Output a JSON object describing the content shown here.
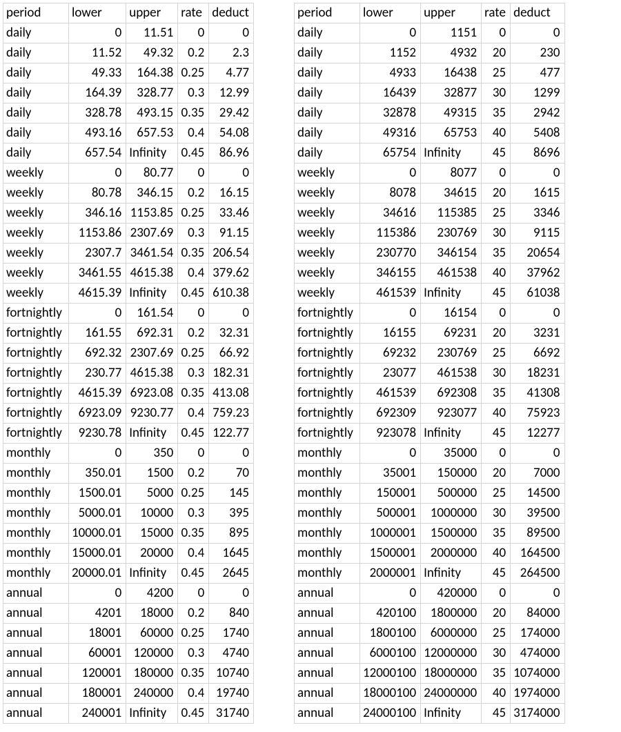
{
  "headers": [
    "period",
    "lower",
    "upper",
    "rate",
    "deduct"
  ],
  "tableLeft": [
    [
      "daily",
      "0",
      "11.51",
      "0",
      "0"
    ],
    [
      "daily",
      "11.52",
      "49.32",
      "0.2",
      "2.3"
    ],
    [
      "daily",
      "49.33",
      "164.38",
      "0.25",
      "4.77"
    ],
    [
      "daily",
      "164.39",
      "328.77",
      "0.3",
      "12.99"
    ],
    [
      "daily",
      "328.78",
      "493.15",
      "0.35",
      "29.42"
    ],
    [
      "daily",
      "493.16",
      "657.53",
      "0.4",
      "54.08"
    ],
    [
      "daily",
      "657.54",
      "Infinity",
      "0.45",
      "86.96"
    ],
    [
      "weekly",
      "0",
      "80.77",
      "0",
      "0"
    ],
    [
      "weekly",
      "80.78",
      "346.15",
      "0.2",
      "16.15"
    ],
    [
      "weekly",
      "346.16",
      "1153.85",
      "0.25",
      "33.46"
    ],
    [
      "weekly",
      "1153.86",
      "2307.69",
      "0.3",
      "91.15"
    ],
    [
      "weekly",
      "2307.7",
      "3461.54",
      "0.35",
      "206.54"
    ],
    [
      "weekly",
      "3461.55",
      "4615.38",
      "0.4",
      "379.62"
    ],
    [
      "weekly",
      "4615.39",
      "Infinity",
      "0.45",
      "610.38"
    ],
    [
      "fortnightly",
      "0",
      "161.54",
      "0",
      "0"
    ],
    [
      "fortnightly",
      "161.55",
      "692.31",
      "0.2",
      "32.31"
    ],
    [
      "fortnightly",
      "692.32",
      "2307.69",
      "0.25",
      "66.92"
    ],
    [
      "fortnightly",
      "230.77",
      "4615.38",
      "0.3",
      "182.31"
    ],
    [
      "fortnightly",
      "4615.39",
      "6923.08",
      "0.35",
      "413.08"
    ],
    [
      "fortnightly",
      "6923.09",
      "9230.77",
      "0.4",
      "759.23"
    ],
    [
      "fortnightly",
      "9230.78",
      "Infinity",
      "0.45",
      "122.77"
    ],
    [
      "monthly",
      "0",
      "350",
      "0",
      "0"
    ],
    [
      "monthly",
      "350.01",
      "1500",
      "0.2",
      "70"
    ],
    [
      "monthly",
      "1500.01",
      "5000",
      "0.25",
      "145"
    ],
    [
      "monthly",
      "5000.01",
      "10000",
      "0.3",
      "395"
    ],
    [
      "monthly",
      "10000.01",
      "15000",
      "0.35",
      "895"
    ],
    [
      "monthly",
      "15000.01",
      "20000",
      "0.4",
      "1645"
    ],
    [
      "monthly",
      "20000.01",
      "Infinity",
      "0.45",
      "2645"
    ],
    [
      "annual",
      "0",
      "4200",
      "0",
      "0"
    ],
    [
      "annual",
      "4201",
      "18000",
      "0.2",
      "840"
    ],
    [
      "annual",
      "18001",
      "60000",
      "0.25",
      "1740"
    ],
    [
      "annual",
      "60001",
      "120000",
      "0.3",
      "4740"
    ],
    [
      "annual",
      "120001",
      "180000",
      "0.35",
      "10740"
    ],
    [
      "annual",
      "180001",
      "240000",
      "0.4",
      "19740"
    ],
    [
      "annual",
      "240001",
      "Infinity",
      "0.45",
      "31740"
    ]
  ],
  "tableRight": [
    [
      "daily",
      "0",
      "1151",
      "0",
      "0"
    ],
    [
      "daily",
      "1152",
      "4932",
      "20",
      "230"
    ],
    [
      "daily",
      "4933",
      "16438",
      "25",
      "477"
    ],
    [
      "daily",
      "16439",
      "32877",
      "30",
      "1299"
    ],
    [
      "daily",
      "32878",
      "49315",
      "35",
      "2942"
    ],
    [
      "daily",
      "49316",
      "65753",
      "40",
      "5408"
    ],
    [
      "daily",
      "65754",
      "Infinity",
      "45",
      "8696"
    ],
    [
      "weekly",
      "0",
      "8077",
      "0",
      "0"
    ],
    [
      "weekly",
      "8078",
      "34615",
      "20",
      "1615"
    ],
    [
      "weekly",
      "34616",
      "115385",
      "25",
      "3346"
    ],
    [
      "weekly",
      "115386",
      "230769",
      "30",
      "9115"
    ],
    [
      "weekly",
      "230770",
      "346154",
      "35",
      "20654"
    ],
    [
      "weekly",
      "346155",
      "461538",
      "40",
      "37962"
    ],
    [
      "weekly",
      "461539",
      "Infinity",
      "45",
      "61038"
    ],
    [
      "fortnightly",
      "0",
      "16154",
      "0",
      "0"
    ],
    [
      "fortnightly",
      "16155",
      "69231",
      "20",
      "3231"
    ],
    [
      "fortnightly",
      "69232",
      "230769",
      "25",
      "6692"
    ],
    [
      "fortnightly",
      "23077",
      "461538",
      "30",
      "18231"
    ],
    [
      "fortnightly",
      "461539",
      "692308",
      "35",
      "41308"
    ],
    [
      "fortnightly",
      "692309",
      "923077",
      "40",
      "75923"
    ],
    [
      "fortnightly",
      "923078",
      "Infinity",
      "45",
      "12277"
    ],
    [
      "monthly",
      "0",
      "35000",
      "0",
      "0"
    ],
    [
      "monthly",
      "35001",
      "150000",
      "20",
      "7000"
    ],
    [
      "monthly",
      "150001",
      "500000",
      "25",
      "14500"
    ],
    [
      "monthly",
      "500001",
      "1000000",
      "30",
      "39500"
    ],
    [
      "monthly",
      "1000001",
      "1500000",
      "35",
      "89500"
    ],
    [
      "monthly",
      "1500001",
      "2000000",
      "40",
      "164500"
    ],
    [
      "monthly",
      "2000001",
      "Infinity",
      "45",
      "264500"
    ],
    [
      "annual",
      "0",
      "420000",
      "0",
      "0"
    ],
    [
      "annual",
      "420100",
      "1800000",
      "20",
      "84000"
    ],
    [
      "annual",
      "1800100",
      "6000000",
      "25",
      "174000"
    ],
    [
      "annual",
      "6000100",
      "12000000",
      "30",
      "474000"
    ],
    [
      "annual",
      "12000100",
      "18000000",
      "35",
      "1074000"
    ],
    [
      "annual",
      "18000100",
      "24000000",
      "40",
      "1974000"
    ],
    [
      "annual",
      "24000100",
      "Infinity",
      "45",
      "3174000"
    ]
  ]
}
